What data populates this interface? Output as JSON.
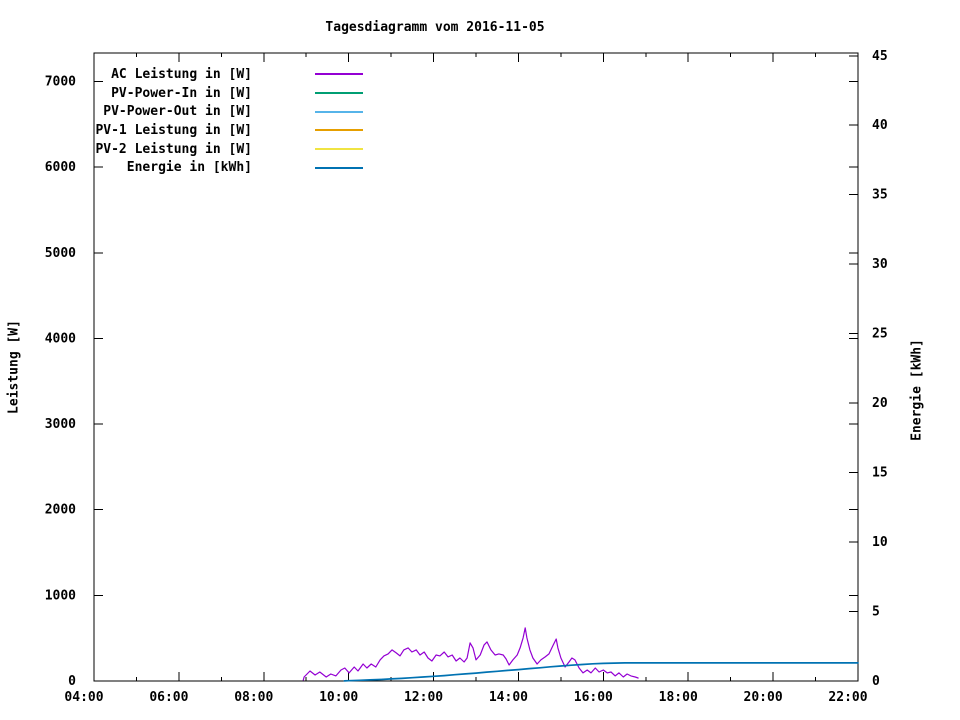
{
  "page": {
    "background": "#ffffff",
    "text_color": "#000000",
    "axis_color": "#000000"
  },
  "chart_data": {
    "type": "line",
    "title": "Tagesdiagramm vom 2016-11-05",
    "xlabel": "",
    "ylabel": "Leistung [W]",
    "y2label": "Energie [kWh]",
    "grid": false,
    "legend_position": "top-left-inside",
    "x_range_hours": [
      4,
      22
    ],
    "x_tick_labels": [
      "04:00",
      "06:00",
      "08:00",
      "10:00",
      "12:00",
      "14:00",
      "16:00",
      "18:00",
      "20:00",
      "22:00"
    ],
    "x_major_tick_hours": [
      4,
      6,
      8,
      10,
      12,
      14,
      16,
      18,
      20,
      22
    ],
    "x_minor_tick_hours": [
      5,
      7,
      9,
      11,
      13,
      15,
      17,
      19,
      21
    ],
    "y1_ticks": [
      0,
      1000,
      2000,
      3000,
      4000,
      5000,
      6000,
      7000
    ],
    "y1_top_value": 7333,
    "y2_ticks": [
      0,
      5,
      10,
      15,
      20,
      25,
      30,
      35,
      40,
      45
    ],
    "y2_top_value": 45.2,
    "legend": [
      {
        "label": "AC Leistung in [W]",
        "color": "#9400d3"
      },
      {
        "label": "PV-Power-In in [W]",
        "color": "#009e73"
      },
      {
        "label": "PV-Power-Out in [W]",
        "color": "#56b4e9"
      },
      {
        "label": "PV-1 Leistung in [W]",
        "color": "#e69f00"
      },
      {
        "label": "PV-2 Leistung in [W]",
        "color": "#f0e442"
      },
      {
        "label": "Energie in [kWh]",
        "color": "#0072b2"
      }
    ],
    "series_without_visible_curve": [
      "PV-Power-In in [W]",
      "PV-Power-Out in [W]",
      "PV-1 Leistung in [W]",
      "PV-2 Leistung in [W]"
    ],
    "series": [
      {
        "name": "AC Leistung in [W]",
        "color": "#9400d3",
        "axis": "y1",
        "stroke_width": 1.2,
        "points": [
          [
            8.93,
            12
          ],
          [
            8.95,
            47
          ],
          [
            9.09,
            117
          ],
          [
            9.21,
            70
          ],
          [
            9.32,
            105
          ],
          [
            9.47,
            47
          ],
          [
            9.58,
            82
          ],
          [
            9.7,
            59
          ],
          [
            9.82,
            129
          ],
          [
            9.91,
            152
          ],
          [
            10.01,
            94
          ],
          [
            10.13,
            164
          ],
          [
            10.22,
            117
          ],
          [
            10.34,
            199
          ],
          [
            10.43,
            152
          ],
          [
            10.53,
            199
          ],
          [
            10.64,
            164
          ],
          [
            10.74,
            246
          ],
          [
            10.83,
            293
          ],
          [
            10.93,
            316
          ],
          [
            11.02,
            363
          ],
          [
            11.12,
            328
          ],
          [
            11.21,
            293
          ],
          [
            11.3,
            363
          ],
          [
            11.4,
            386
          ],
          [
            11.49,
            339
          ],
          [
            11.59,
            363
          ],
          [
            11.68,
            304
          ],
          [
            11.78,
            339
          ],
          [
            11.87,
            269
          ],
          [
            11.96,
            234
          ],
          [
            12.06,
            304
          ],
          [
            12.15,
            293
          ],
          [
            12.25,
            339
          ],
          [
            12.34,
            281
          ],
          [
            12.44,
            304
          ],
          [
            12.53,
            234
          ],
          [
            12.62,
            269
          ],
          [
            12.72,
            222
          ],
          [
            12.79,
            269
          ],
          [
            12.86,
            445
          ],
          [
            12.93,
            386
          ],
          [
            13.0,
            246
          ],
          [
            13.1,
            304
          ],
          [
            13.19,
            421
          ],
          [
            13.26,
            456
          ],
          [
            13.35,
            363
          ],
          [
            13.45,
            304
          ],
          [
            13.54,
            316
          ],
          [
            13.64,
            304
          ],
          [
            13.71,
            257
          ],
          [
            13.78,
            187
          ],
          [
            13.87,
            246
          ],
          [
            13.97,
            304
          ],
          [
            14.04,
            386
          ],
          [
            14.11,
            503
          ],
          [
            14.16,
            620
          ],
          [
            14.2,
            503
          ],
          [
            14.27,
            363
          ],
          [
            14.34,
            269
          ],
          [
            14.44,
            199
          ],
          [
            14.53,
            246
          ],
          [
            14.63,
            281
          ],
          [
            14.72,
            316
          ],
          [
            14.81,
            410
          ],
          [
            14.89,
            491
          ],
          [
            14.93,
            386
          ],
          [
            15.0,
            269
          ],
          [
            15.1,
            164
          ],
          [
            15.19,
            222
          ],
          [
            15.26,
            269
          ],
          [
            15.33,
            246
          ],
          [
            15.43,
            152
          ],
          [
            15.52,
            94
          ],
          [
            15.62,
            129
          ],
          [
            15.71,
            94
          ],
          [
            15.81,
            152
          ],
          [
            15.9,
            105
          ],
          [
            16.0,
            129
          ],
          [
            16.09,
            94
          ],
          [
            16.18,
            105
          ],
          [
            16.28,
            59
          ],
          [
            16.37,
            94
          ],
          [
            16.47,
            47
          ],
          [
            16.56,
            82
          ],
          [
            16.65,
            59
          ],
          [
            16.75,
            47
          ],
          [
            16.82,
            35
          ]
        ]
      },
      {
        "name": "Energie in [kWh]",
        "color": "#0072b2",
        "axis": "y2",
        "stroke_width": 1.7,
        "points": [
          [
            9.9,
            0.01
          ],
          [
            10.0,
            0.02
          ],
          [
            10.25,
            0.05
          ],
          [
            10.5,
            0.08
          ],
          [
            10.75,
            0.11
          ],
          [
            11.0,
            0.15
          ],
          [
            11.25,
            0.19
          ],
          [
            11.5,
            0.24
          ],
          [
            11.75,
            0.29
          ],
          [
            12.0,
            0.34
          ],
          [
            12.25,
            0.39
          ],
          [
            12.5,
            0.45
          ],
          [
            12.75,
            0.51
          ],
          [
            13.0,
            0.57
          ],
          [
            13.25,
            0.64
          ],
          [
            13.5,
            0.7
          ],
          [
            13.75,
            0.76
          ],
          [
            14.0,
            0.82
          ],
          [
            14.25,
            0.89
          ],
          [
            14.5,
            0.95
          ],
          [
            14.75,
            1.02
          ],
          [
            15.0,
            1.08
          ],
          [
            15.25,
            1.14
          ],
          [
            15.5,
            1.19
          ],
          [
            15.75,
            1.24
          ],
          [
            16.0,
            1.27
          ],
          [
            16.25,
            1.29
          ],
          [
            16.5,
            1.3
          ],
          [
            17.0,
            1.3
          ],
          [
            18.0,
            1.3
          ],
          [
            19.0,
            1.3
          ],
          [
            20.0,
            1.3
          ],
          [
            21.0,
            1.3
          ],
          [
            22.0,
            1.3
          ]
        ]
      }
    ]
  }
}
